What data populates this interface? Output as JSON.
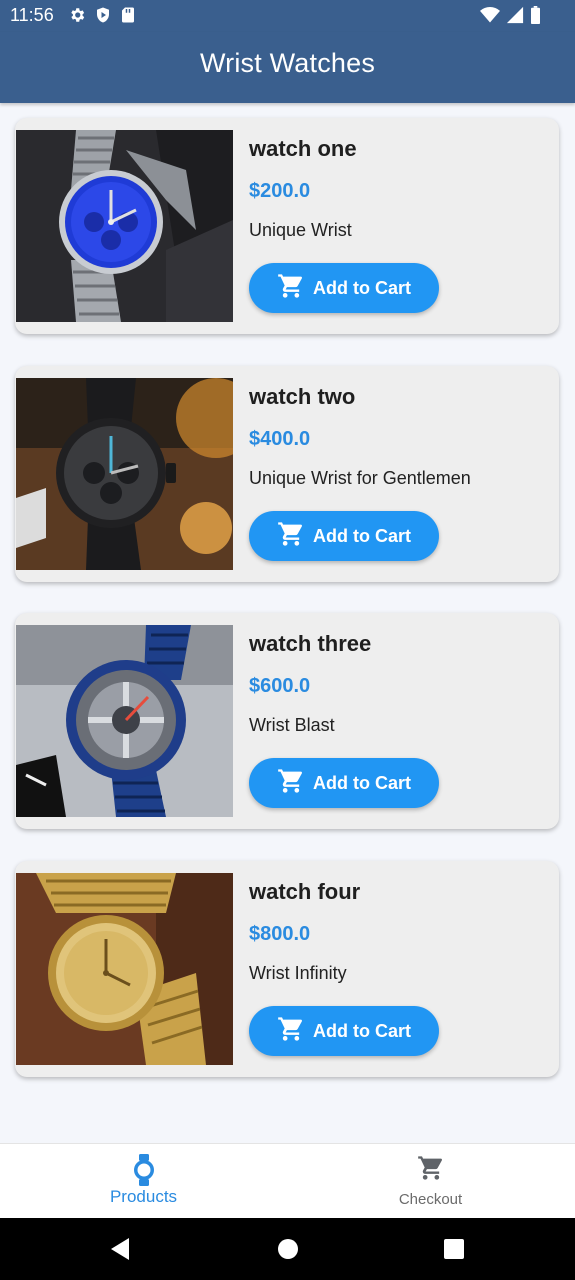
{
  "status_bar": {
    "time": "11:56",
    "left_icons": [
      "gear-icon",
      "shield-icon",
      "sd-card-icon"
    ],
    "right_icons": [
      "wifi-icon",
      "cell-signal-icon",
      "battery-icon"
    ]
  },
  "app_bar": {
    "title": "Wrist Watches"
  },
  "products": [
    {
      "name": "watch one",
      "price": "$200.0",
      "description": "Unique Wrist",
      "button_label": "Add to Cart"
    },
    {
      "name": "watch two",
      "price": "$400.0",
      "description": "Unique Wrist for Gentlemen",
      "button_label": "Add to Cart"
    },
    {
      "name": "watch three",
      "price": "$600.0",
      "description": "Wrist Blast",
      "button_label": "Add to Cart"
    },
    {
      "name": "watch four",
      "price": "$800.0",
      "description": "Wrist Infinity",
      "button_label": "Add to Cart"
    }
  ],
  "bottom_nav": {
    "items": [
      {
        "label": "Products",
        "icon": "watch-icon",
        "active": true
      },
      {
        "label": "Checkout",
        "icon": "cart-icon",
        "active": false
      }
    ]
  },
  "system_nav": {
    "buttons": [
      "back-icon",
      "home-icon",
      "recents-icon"
    ]
  },
  "colors": {
    "app_bar": "#3a5f8e",
    "accent": "#2196f3",
    "price": "#2a8be0",
    "card": "#eeeeee",
    "background": "#f4f6fb"
  }
}
